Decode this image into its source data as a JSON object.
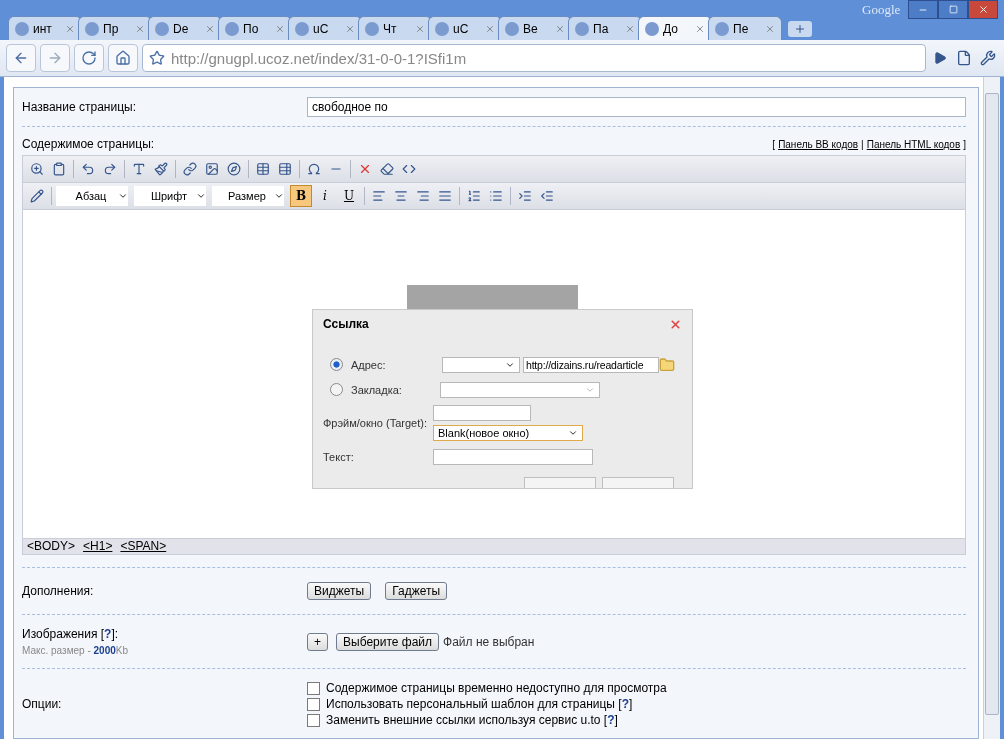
{
  "browser": {
    "brand": "Google",
    "tabs": [
      {
        "label": "инт",
        "selected": false
      },
      {
        "label": "Пр",
        "selected": false
      },
      {
        "label": "De",
        "selected": false
      },
      {
        "label": "По",
        "selected": false
      },
      {
        "label": "uC",
        "selected": false
      },
      {
        "label": "Чт",
        "selected": false
      },
      {
        "label": "uC",
        "selected": false
      },
      {
        "label": "Ве",
        "selected": false
      },
      {
        "label": "Па",
        "selected": false
      },
      {
        "label": "До",
        "selected": true
      },
      {
        "label": "Пе",
        "selected": false
      }
    ],
    "address": {
      "host": "http://gnugpl.ucoz.net",
      "path": "/index/31-0-0-1?ISfi1m"
    }
  },
  "form": {
    "title_label": "Название страницы:",
    "title_value": "свободное по",
    "content_label": "Содержимое страницы:",
    "panel_links": [
      {
        "kind": "mark",
        "text": "["
      },
      {
        "kind": "link",
        "text": "Панель BB кодов"
      },
      {
        "kind": "mark",
        "text": "|"
      },
      {
        "kind": "link",
        "text": "Панель HTML кодов"
      },
      {
        "kind": "mark",
        "text": "]"
      }
    ],
    "format_selects": [
      "Абзац",
      "Шрифт",
      "Размер"
    ],
    "style_buttons": [
      {
        "label": "B",
        "selected": true
      },
      {
        "label": "i",
        "selected": false
      },
      {
        "label": "U",
        "selected": false
      }
    ],
    "path": [
      {
        "label": "<BODY>",
        "link": false
      },
      {
        "label": "<H1>",
        "link": true
      },
      {
        "label": "<SPAN>",
        "link": true
      }
    ],
    "addons_label": "Дополнения:",
    "addons_buttons": [
      "Виджеты",
      "Гаджеты"
    ],
    "images_label": "Изображения [**?**]:",
    "images_hint": "Макс. размер - **2000**Kb",
    "add_button": "+",
    "file_button": "Выберите файл",
    "file_status": "Файл не выбран",
    "options_label": "Опции:",
    "options": [
      {
        "label": "Содержимое страницы временно недоступно для просмотра",
        "checked": false
      },
      {
        "label": "Использовать персональный шаблон для страницы [**?**]",
        "checked": false
      },
      {
        "label": "Заменить внешние ссылки используя сервис u.to [**?**]",
        "checked": false
      }
    ]
  },
  "dialog": {
    "title": "Ссылка",
    "radios": [
      {
        "label": "Адрес:",
        "selected": true
      },
      {
        "label": "Закладка:",
        "selected": false
      }
    ],
    "url": "http://dizains.ru/readarticle",
    "target_label": "Фрэйм/окно (Target):",
    "target_select": "Blank(новое окно)",
    "text_label": "Текст:"
  }
}
